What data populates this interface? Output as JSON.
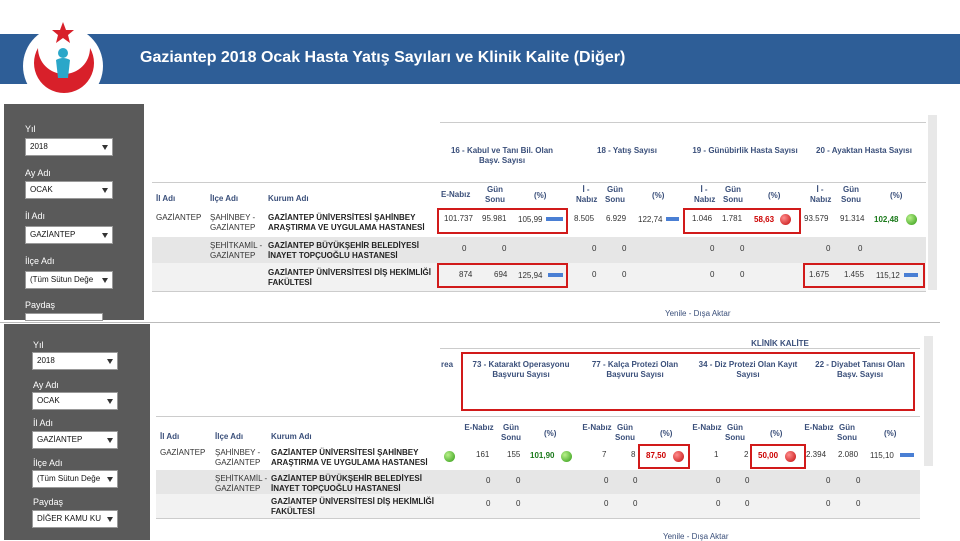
{
  "slide": {
    "title": "Gaziantep 2018 Ocak Hasta Yatış Sayıları ve Klinik Kalite (Diğer)"
  },
  "shot1": {
    "filters": [
      {
        "label": "Yıl",
        "value": "2018"
      },
      {
        "label": "Ay Adı",
        "value": "OCAK"
      },
      {
        "label": "İl Adı",
        "value": "GAZİANTEP"
      },
      {
        "label": "İlçe Adı",
        "value": "(Tüm Sütun Değe"
      },
      {
        "label": "Paydaş",
        "value": ""
      }
    ],
    "groups": [
      "16 - Kabul ve Tanı Bil. Olan Başv. Sayısı",
      "18 - Yatış Sayısı",
      "19 - Günübirlik Hasta Sayısı",
      "20 - Ayaktan Hasta Sayısı"
    ],
    "cols": {
      "il": "İl Adı",
      "ilce": "İlçe Adı",
      "kurum": "Kurum Adı",
      "enabiz": "E-Nabız",
      "gunsonu": "Gün Sonu",
      "pct": "(%)",
      "inabiz": "İ - Nabız"
    },
    "rows": [
      {
        "il": "GAZİANTEP",
        "ilce": "ŞAHİNBEY - GAZİANTEP",
        "kurum": "GAZİANTEP ÜNİVERSİTESİ ŞAHİNBEY ARAŞTIRMA VE UYGULAMA HASTANESİ",
        "v": [
          "101.737",
          "95.981",
          "105,99",
          "8.505",
          "6.929",
          "122,74",
          "1.046",
          "1.781",
          "58,63",
          "93.579",
          "91.314",
          "102,48"
        ]
      },
      {
        "il": "",
        "ilce": "ŞEHİTKAMİL - GAZİANTEP",
        "kurum": "GAZİANTEP BÜYÜKŞEHİR BELEDİYESİ İNAYET TOPÇUOĞLU HASTANESİ",
        "v": [
          "0",
          "0",
          "",
          "0",
          "0",
          "",
          "0",
          "0",
          "",
          "0",
          "0",
          ""
        ]
      },
      {
        "il": "",
        "ilce": "",
        "kurum": "GAZİANTEP ÜNİVERSİTESİ DİŞ HEKİMLİĞİ FAKÜLTESİ",
        "v": [
          "874",
          "694",
          "125,94",
          "0",
          "0",
          "",
          "0",
          "0",
          "",
          "1.675",
          "1.455",
          "115,12"
        ]
      }
    ],
    "footer": "Yenile - Dışa Aktar"
  },
  "shot2": {
    "filters": [
      {
        "label": "Yıl",
        "value": "2018"
      },
      {
        "label": "Ay Adı",
        "value": "OCAK"
      },
      {
        "label": "İl Adı",
        "value": "GAZİANTEP"
      },
      {
        "label": "İlçe Adı",
        "value": "(Tüm Sütun Değe"
      },
      {
        "label": "Paydaş",
        "value": "DİĞER KAMU KU"
      }
    ],
    "klinik": "KLİNİK KALİTE",
    "area": "rea",
    "groups": [
      "73 - Katarakt Operasyonu Başvuru Sayısı",
      "77 - Kalça Protezi Olan Başvuru Sayısı",
      "34 - Diz Protezi Olan Kayıt Sayısı",
      "22 - Diyabet Tanısı Olan Başv. Sayısı"
    ],
    "cols": {
      "il": "İl Adı",
      "ilce": "İlçe Adı",
      "kurum": "Kurum Adı",
      "enabiz": "E-Nabız",
      "gunsonu": "Gün Sonu",
      "pct": "(%)"
    },
    "rows": [
      {
        "il": "GAZİANTEP",
        "ilce": "ŞAHİNBEY - GAZİANTEP",
        "kurum": "GAZİANTEP ÜNİVERSİTESİ ŞAHİNBEY ARAŞTIRMA VE UYGULAMA HASTANESİ",
        "v": [
          "161",
          "155",
          "101,90",
          "7",
          "8",
          "87,50",
          "1",
          "2",
          "50,00",
          "2.394",
          "2.080",
          "115,10"
        ]
      },
      {
        "il": "",
        "ilce": "ŞEHİTKAMİL - GAZİANTEP",
        "kurum": "GAZİANTEP BÜYÜKŞEHİR BELEDİYESİ İNAYET TOPÇUOĞLU HASTANESİ",
        "v": [
          "0",
          "0",
          "",
          "0",
          "0",
          "",
          "0",
          "0",
          "",
          "0",
          "0",
          ""
        ]
      },
      {
        "il": "",
        "ilce": "",
        "kurum": "GAZİANTEP ÜNİVERSİTESİ DİŞ HEKİMLİĞİ FAKÜLTESİ",
        "v": [
          "0",
          "0",
          "",
          "0",
          "0",
          "",
          "0",
          "0",
          "",
          "0",
          "0",
          ""
        ]
      }
    ],
    "footer": "Yenile - Dışa Aktar"
  }
}
